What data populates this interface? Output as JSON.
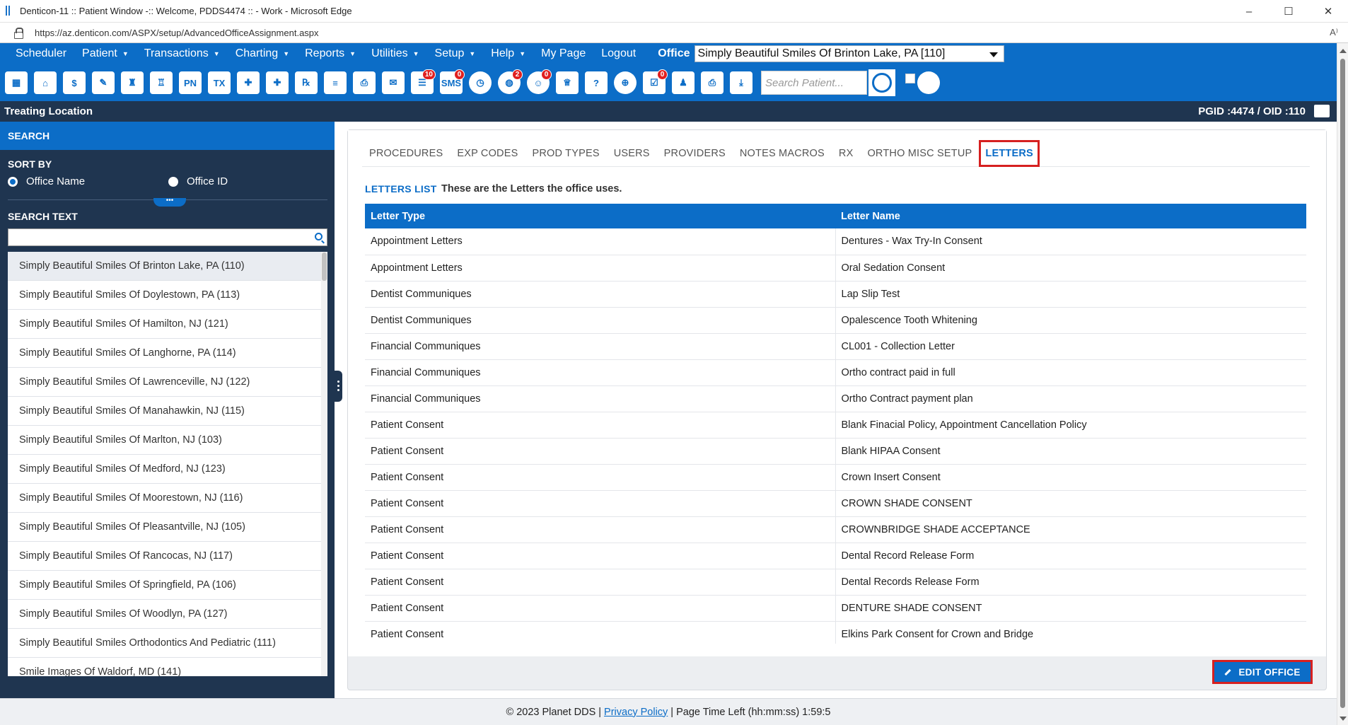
{
  "browser": {
    "title": "Denticon-11 :: Patient Window -:: Welcome, PDDS4474 :: - Work - Microsoft Edge",
    "url": "https://az.denticon.com/ASPX/setup/AdvancedOfficeAssignment.aspx",
    "controls": [
      "–",
      "☐",
      "✕"
    ],
    "read_aloud": "A⁾"
  },
  "menu": {
    "items": [
      {
        "label": "Scheduler",
        "caret": false
      },
      {
        "label": "Patient",
        "caret": true
      },
      {
        "label": "Transactions",
        "caret": true
      },
      {
        "label": "Charting",
        "caret": true
      },
      {
        "label": "Reports",
        "caret": true
      },
      {
        "label": "Utilities",
        "caret": true
      },
      {
        "label": "Setup",
        "caret": true
      },
      {
        "label": "Help",
        "caret": true
      },
      {
        "label": "My Page",
        "caret": false
      },
      {
        "label": "Logout",
        "caret": false
      }
    ],
    "office_label": "Office",
    "office_value": "Simply Beautiful Smiles Of Brinton Lake, PA [110]"
  },
  "toolbar": {
    "icons": [
      {
        "name": "calendar-icon",
        "glyph": "▦",
        "badge": ""
      },
      {
        "name": "home-icon",
        "glyph": "⌂",
        "badge": ""
      },
      {
        "name": "dollar-icon",
        "glyph": "$",
        "badge": ""
      },
      {
        "name": "clipboard-pencil-icon",
        "glyph": "✎",
        "badge": ""
      },
      {
        "name": "tooth-chart-icon",
        "glyph": "♜",
        "badge": ""
      },
      {
        "name": "tooth-perio-icon",
        "glyph": "♖",
        "badge": ""
      },
      {
        "name": "progress-notes-icon",
        "glyph": "PN",
        "badge": ""
      },
      {
        "name": "treatment-icon",
        "glyph": "TX",
        "badge": ""
      },
      {
        "name": "add-patient-icon",
        "glyph": "✚",
        "badge": ""
      },
      {
        "name": "add-family-icon",
        "glyph": "✚",
        "badge": ""
      },
      {
        "name": "prescription-icon",
        "glyph": "℞",
        "badge": ""
      },
      {
        "name": "document-icon",
        "glyph": "≡",
        "badge": ""
      },
      {
        "name": "scan-icon",
        "glyph": "⎙",
        "badge": ""
      },
      {
        "name": "mail-icon",
        "glyph": "✉",
        "badge": ""
      },
      {
        "name": "message-icon",
        "glyph": "☰",
        "badge": "10"
      },
      {
        "name": "sms-icon",
        "glyph": "SMS",
        "badge": "0"
      },
      {
        "name": "clock-icon",
        "glyph": "◷",
        "badge": ""
      },
      {
        "name": "globe-users-icon",
        "glyph": "◍",
        "badge": "2"
      },
      {
        "name": "support-icon",
        "glyph": "☺",
        "badge": "0"
      },
      {
        "name": "tooth-icon",
        "glyph": "♕",
        "badge": ""
      },
      {
        "name": "tooth-help-icon",
        "glyph": "?",
        "badge": ""
      },
      {
        "name": "globe-icon",
        "glyph": "⊕",
        "badge": ""
      },
      {
        "name": "checklist-icon",
        "glyph": "☑",
        "badge": "0"
      },
      {
        "name": "staff-icon",
        "glyph": "♟",
        "badge": ""
      },
      {
        "name": "printer-icon",
        "glyph": "⎙",
        "badge": ""
      },
      {
        "name": "download-icon",
        "glyph": "⤓",
        "badge": ""
      }
    ],
    "search_placeholder": "Search Patient..."
  },
  "location_bar": {
    "label": "Treating Location",
    "pgid": "PGID :4474  /  OID :110"
  },
  "sidebar": {
    "search_heading": "SEARCH",
    "sort_by": "SORT BY",
    "sort_options": [
      "Office Name",
      "Office ID"
    ],
    "collapse_glyph": "•••",
    "search_text_label": "SEARCH TEXT",
    "offices": [
      "Simply Beautiful Smiles Of Brinton Lake, PA (110)",
      "Simply Beautiful Smiles Of Doylestown, PA (113)",
      "Simply Beautiful Smiles Of Hamilton, NJ (121)",
      "Simply Beautiful Smiles Of Langhorne, PA (114)",
      "Simply Beautiful Smiles Of Lawrenceville, NJ (122)",
      "Simply Beautiful Smiles Of Manahawkin, NJ (115)",
      "Simply Beautiful Smiles Of Marlton, NJ (103)",
      "Simply Beautiful Smiles Of Medford, NJ (123)",
      "Simply Beautiful Smiles Of Moorestown, NJ (116)",
      "Simply Beautiful Smiles Of Pleasantville, NJ (105)",
      "Simply Beautiful Smiles Of Rancocas, NJ (117)",
      "Simply Beautiful Smiles Of Springfield, PA (106)",
      "Simply Beautiful Smiles Of Woodlyn, PA (127)",
      "Simply Beautiful Smiles Orthodontics And Pediatric (111)",
      "Smile Images Of Waldorf, MD (141)"
    ]
  },
  "main": {
    "tabs": [
      "PROCEDURES",
      "EXP CODES",
      "PROD TYPES",
      "USERS",
      "PROVIDERS",
      "NOTES MACROS",
      "RX",
      "ORTHO MISC SETUP",
      "LETTERS"
    ],
    "active_tab": "LETTERS",
    "list_title": "LETTERS LIST",
    "list_desc": "These are the Letters the office uses.",
    "columns": [
      "Letter Type",
      "Letter Name"
    ],
    "rows": [
      [
        "Appointment Letters",
        "Dentures - Wax Try-In Consent"
      ],
      [
        "Appointment Letters",
        "Oral Sedation Consent"
      ],
      [
        "Dentist Communiques",
        "Lap Slip Test"
      ],
      [
        "Dentist Communiques",
        "Opalescence Tooth Whitening"
      ],
      [
        "Financial Communiques",
        "CL001 - Collection Letter"
      ],
      [
        "Financial Communiques",
        "Ortho contract paid in full"
      ],
      [
        "Financial Communiques",
        "Ortho Contract payment plan"
      ],
      [
        "Patient Consent",
        "Blank Finacial Policy, Appointment Cancellation Policy"
      ],
      [
        "Patient Consent",
        "Blank HIPAA Consent"
      ],
      [
        "Patient Consent",
        "Crown Insert Consent"
      ],
      [
        "Patient Consent",
        "CROWN SHADE CONSENT"
      ],
      [
        "Patient Consent",
        "CROWNBRIDGE SHADE ACCEPTANCE"
      ],
      [
        "Patient Consent",
        "Dental Record Release Form"
      ],
      [
        "Patient Consent",
        "Dental Records Release Form"
      ],
      [
        "Patient Consent",
        "DENTURE SHADE CONSENT"
      ],
      [
        "Patient Consent",
        "Elkins Park Consent for Crown and Bridge"
      ]
    ],
    "edit_button": "EDIT OFFICE"
  },
  "footer": {
    "copyright": "© 2023 Planet DDS |",
    "privacy": "Privacy Policy",
    "time_left": "| Page Time Left (hh:mm:ss) 1:59:5"
  },
  "colors": {
    "brand_blue": "#0c6dc7",
    "navy": "#1f3550",
    "highlight_red": "#d62020"
  }
}
